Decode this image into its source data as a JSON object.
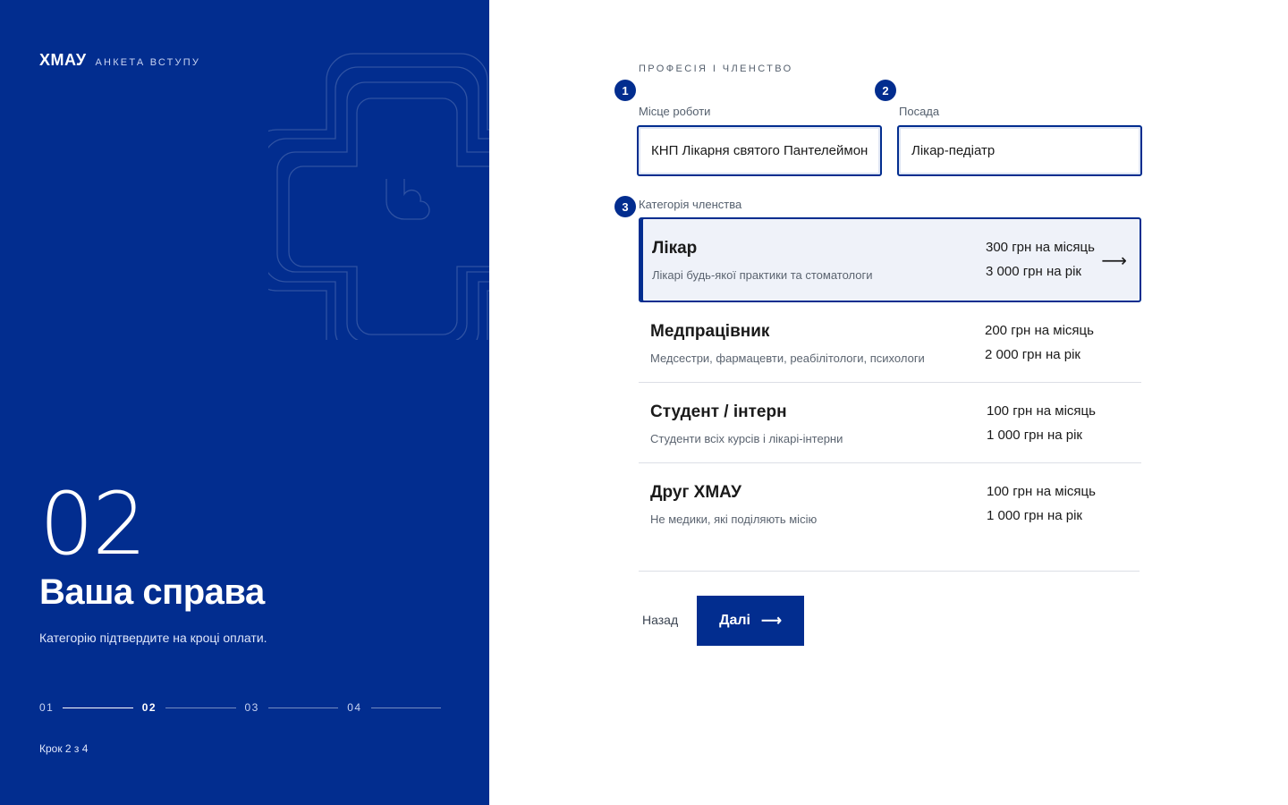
{
  "brand": {
    "name": "ХМАУ",
    "subtitle": "АНКЕТА ВСТУПУ"
  },
  "step": {
    "number": "02",
    "title": "Ваша справа",
    "description": "Категорію підтвердите на кроці оплати.",
    "progress": [
      "01",
      "02",
      "03",
      "04"
    ],
    "active_index": 1,
    "of_label": "Крок 2 з 4"
  },
  "section": {
    "title": "ПРОФЕСІЯ І ЧЛЕНСТВО"
  },
  "fields": {
    "workplace": {
      "badge": "1",
      "label": "Місце роботи",
      "value": "КНП Лікарня святого Пантелеймона"
    },
    "position": {
      "badge": "2",
      "label": "Посада",
      "value": "Лікар-педіатр"
    }
  },
  "membership": {
    "badge": "3",
    "label": "Категорія членства",
    "selected_index": 0,
    "options": [
      {
        "name": "Лікар",
        "desc": "Лікарі будь-якої практики та стоматологи",
        "per_month": "300 грн на місяць",
        "per_year": "3 000 грн на рік"
      },
      {
        "name": "Медпрацівник",
        "desc": "Медсестри, фармацевти, реабілітологи, психологи",
        "per_month": "200 грн на місяць",
        "per_year": "2 000 грн на рік"
      },
      {
        "name": "Студент / інтерн",
        "desc": "Студенти всіх курсів і лікарі-інтерни",
        "per_month": "100 грн на місяць",
        "per_year": "1 000 грн на рік"
      },
      {
        "name": "Друг ХМАУ",
        "desc": "Не медики, які поділяють місію",
        "per_month": "100 грн на місяць",
        "per_year": "1 000 грн на рік"
      }
    ]
  },
  "actions": {
    "back_label": "Назад",
    "next_label": "Далі"
  },
  "colors": {
    "primary": "#022d8f",
    "selected_bg": "#eff2f9",
    "divider": "#dcdfe6"
  },
  "icons": {
    "arrow": "arrow-right-icon",
    "emblem": "cross-heart-emblem-icon"
  }
}
